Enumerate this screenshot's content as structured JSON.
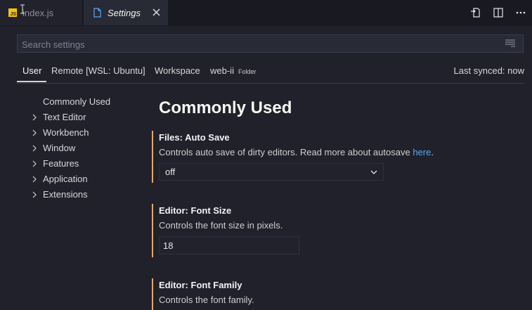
{
  "tabs": [
    {
      "label": "index.js",
      "icon": "js-file-icon",
      "active": false
    },
    {
      "label": "Settings",
      "icon": "settings-file-icon",
      "active": true
    }
  ],
  "js_badge": "JS",
  "search": {
    "placeholder": "Search settings",
    "value": ""
  },
  "scopes": {
    "user": "User",
    "remote": "Remote [WSL: Ubuntu]",
    "workspace": "Workspace",
    "folder": "web-ii",
    "folder_tag": "Folder",
    "last_synced": "Last synced: now"
  },
  "toc": {
    "items": [
      "Commonly Used",
      "Text Editor",
      "Workbench",
      "Window",
      "Features",
      "Application",
      "Extensions"
    ]
  },
  "section_title": "Commonly Used",
  "settings": {
    "auto_save": {
      "category": "Files: ",
      "name": "Auto Save",
      "description": "Controls auto save of dirty editors. Read more about autosave ",
      "link_text": "here",
      "description_end": ".",
      "value": "off"
    },
    "font_size": {
      "category": "Editor: ",
      "name": "Font Size",
      "description": "Controls the font size in pixels.",
      "value": "18"
    },
    "font_family": {
      "category": "Editor: ",
      "name": "Font Family",
      "description": "Controls the font family."
    }
  },
  "colors": {
    "accent_modified": "#e0a96d",
    "link": "#5aa8f5",
    "background": "#20212b"
  }
}
